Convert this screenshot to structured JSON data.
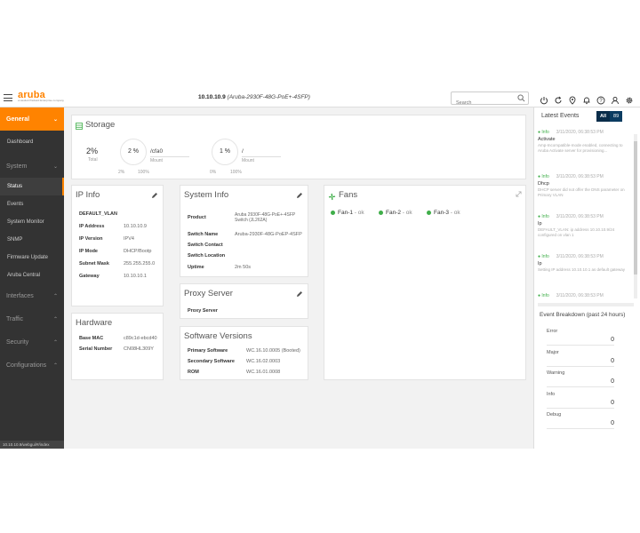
{
  "header": {
    "logo_brand": "aruba",
    "logo_tagline": "a Hewlett Packard Enterprise company",
    "device_ip": "10.10.10.9",
    "device_model": "(Aruba-2930F-48G-PoE+-4SFP)",
    "search_placeholder": "Search"
  },
  "tools": [
    "power-icon",
    "refresh-icon",
    "location-icon",
    "bell-icon",
    "help-icon",
    "user-icon",
    "settings-icon"
  ],
  "sidebar": {
    "sections": [
      {
        "label": "General",
        "items": [
          "Dashboard"
        ]
      },
      {
        "label": "System",
        "items": [
          "Status",
          "Events",
          "System Monitor",
          "SNMP",
          "Firmware Update",
          "Aruba Central"
        ]
      },
      {
        "label": "Interfaces"
      },
      {
        "label": "Traffic"
      },
      {
        "label": "Security"
      },
      {
        "label": "Configurations"
      }
    ],
    "footer": "10.10.10.9/webgui/#/index"
  },
  "storage": {
    "title": "Storage",
    "total_value": "2%",
    "total_label": "Total",
    "mounts": [
      {
        "gauge": "2 %",
        "path": "/cfa0",
        "mount_label": "Mount",
        "min": "2%",
        "max": "100%"
      },
      {
        "gauge": "1 %",
        "path": "/",
        "mount_label": "Mount",
        "min": "0%",
        "max": "100%"
      }
    ]
  },
  "ip_info": {
    "title": "IP Info",
    "vlan": "DEFAULT_VLAN",
    "rows": [
      {
        "k": "IP Address",
        "v": "10.10.10.9"
      },
      {
        "k": "IP Version",
        "v": "IPV4"
      },
      {
        "k": "IP Mode",
        "v": "DHCP/Bootp"
      },
      {
        "k": "Subnet Mask",
        "v": "255.255.255.0"
      },
      {
        "k": "Gateway",
        "v": "10.10.10.1"
      }
    ]
  },
  "hardware": {
    "title": "Hardware",
    "rows": [
      {
        "k": "Base MAC",
        "v": "c89c1d-ebcd40"
      },
      {
        "k": "Serial Number",
        "v": "CN08HL309Y"
      }
    ]
  },
  "system_info": {
    "title": "System Info",
    "product_label": "Product",
    "product_value": "Aruba 2930F-48G-PoE+-4SFP Switch (JL262A)",
    "rows": [
      {
        "k": "Switch Name",
        "v": "Aruba-2930F-48G-PoEP-4SFP"
      },
      {
        "k": "Switch Contact",
        "v": ""
      },
      {
        "k": "Switch Location",
        "v": ""
      },
      {
        "k": "Uptime",
        "v": "2m 50s"
      }
    ]
  },
  "proxy": {
    "title": "Proxy Server",
    "label": "Proxy Server"
  },
  "software": {
    "title": "Software Versions",
    "rows": [
      {
        "k": "Primary Software",
        "v": "WC.16.10.0005 (Booted)"
      },
      {
        "k": "Secondary Software",
        "v": "WC.16.02.0003"
      },
      {
        "k": "ROM",
        "v": "WC.16.01.0008"
      }
    ]
  },
  "fans": {
    "title": "Fans",
    "items": [
      {
        "name": "Fan-1",
        "status": "- ok"
      },
      {
        "name": "Fan-2",
        "status": "- ok"
      },
      {
        "name": "Fan-3",
        "status": "- ok"
      }
    ]
  },
  "latest_events": {
    "title": "Latest Events",
    "tab_all": "All",
    "tab_count": "89",
    "events": [
      {
        "level": "Info",
        "time": "3/11/2020, 06:38:53 PM",
        "category": "Activate",
        "message": "Amp-Incompatible-mode enabled, connecting to Aruba Activate server for provisioning..."
      },
      {
        "level": "Info",
        "time": "3/11/2020, 06:38:53 PM",
        "category": "Dhcp",
        "message": "DHCP server did not offer the DNS parameter on Primary VLAN"
      },
      {
        "level": "Info",
        "time": "3/11/2020, 06:38:53 PM",
        "category": "Ip",
        "message": "DEFAULT_VLAN: ip address 10.10.10.9/24 configured on vlan 1"
      },
      {
        "level": "Info",
        "time": "3/11/2020, 06:38:53 PM",
        "category": "Ip",
        "message": "Setting IP address 10.10.10.1 as default gateway"
      },
      {
        "level": "Info",
        "time": "3/11/2020, 06:38:53 PM",
        "category": "",
        "message": ""
      }
    ]
  },
  "event_breakdown": {
    "title": "Event Breakdown (past 24 hours)",
    "rows": [
      {
        "label": "Error",
        "count": "0"
      },
      {
        "label": "Major",
        "count": "0"
      },
      {
        "label": "Warning",
        "count": "0"
      },
      {
        "label": "Info",
        "count": "0"
      },
      {
        "label": "Debug",
        "count": "0"
      }
    ]
  }
}
